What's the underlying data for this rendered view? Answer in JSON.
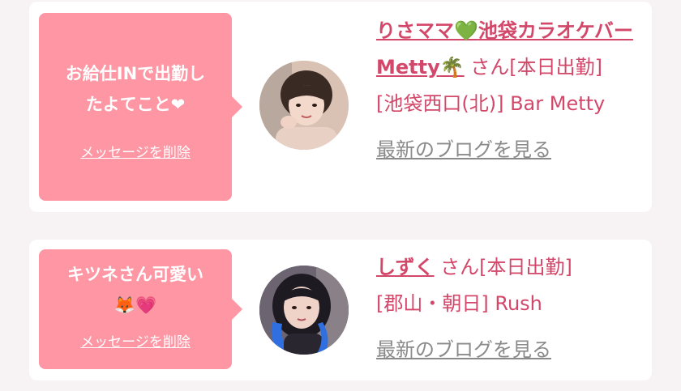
{
  "messages": [
    {
      "bubble_line1": "お給仕INで出勤し",
      "bubble_line2": "たよてこと❤",
      "delete_label": "メッセージを削除",
      "name_a": "りさママ",
      "name_heart": "💚",
      "name_b": "池袋カラオケバーMetty",
      "name_palm": "🌴",
      "suffix": "さん[本日出勤]",
      "location": "[池袋西口(北)] Bar Metty",
      "blog_label": "最新のブログを見る"
    },
    {
      "bubble_line1": "キツネさん可愛い",
      "bubble_line2": "🦊💗",
      "delete_label": "メッセージを削除",
      "name": "しずく",
      "suffix": "さん[本日出勤]",
      "location": "[郡山・朝日] Rush",
      "blog_label": "最新のブログを見る"
    }
  ]
}
